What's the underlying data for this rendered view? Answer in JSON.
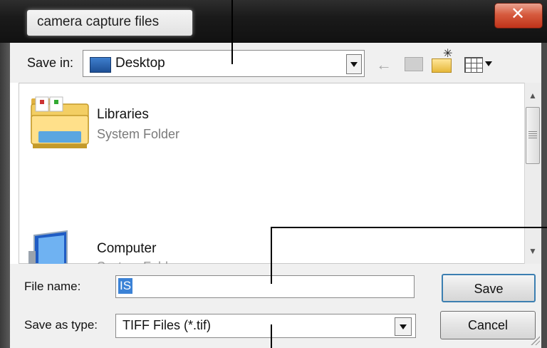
{
  "window": {
    "title": "camera capture files",
    "close_glyph": "✕"
  },
  "toolbar": {
    "save_in_label": "Save in:",
    "location": "Desktop",
    "icons": [
      "desktop-icon",
      "back-arrow-icon",
      "up-folder-icon",
      "new-folder-icon",
      "views-menu-icon"
    ]
  },
  "file_list": {
    "items": [
      {
        "name": "Libraries",
        "type": "System Folder",
        "icon": "libraries-folder-icon"
      },
      {
        "name": "Computer",
        "type": "System Folder",
        "icon": "computer-icon"
      }
    ]
  },
  "form": {
    "file_name_label": "File name:",
    "file_name_value": "IS",
    "save_as_type_label": "Save as type:",
    "save_as_type_value": "TIFF Files (*.tif)"
  },
  "buttons": {
    "save": "Save",
    "cancel": "Cancel"
  },
  "colors": {
    "selection": "#3b82d6",
    "close_button": "#c8442a",
    "title_bar": "#1a1a1a"
  }
}
